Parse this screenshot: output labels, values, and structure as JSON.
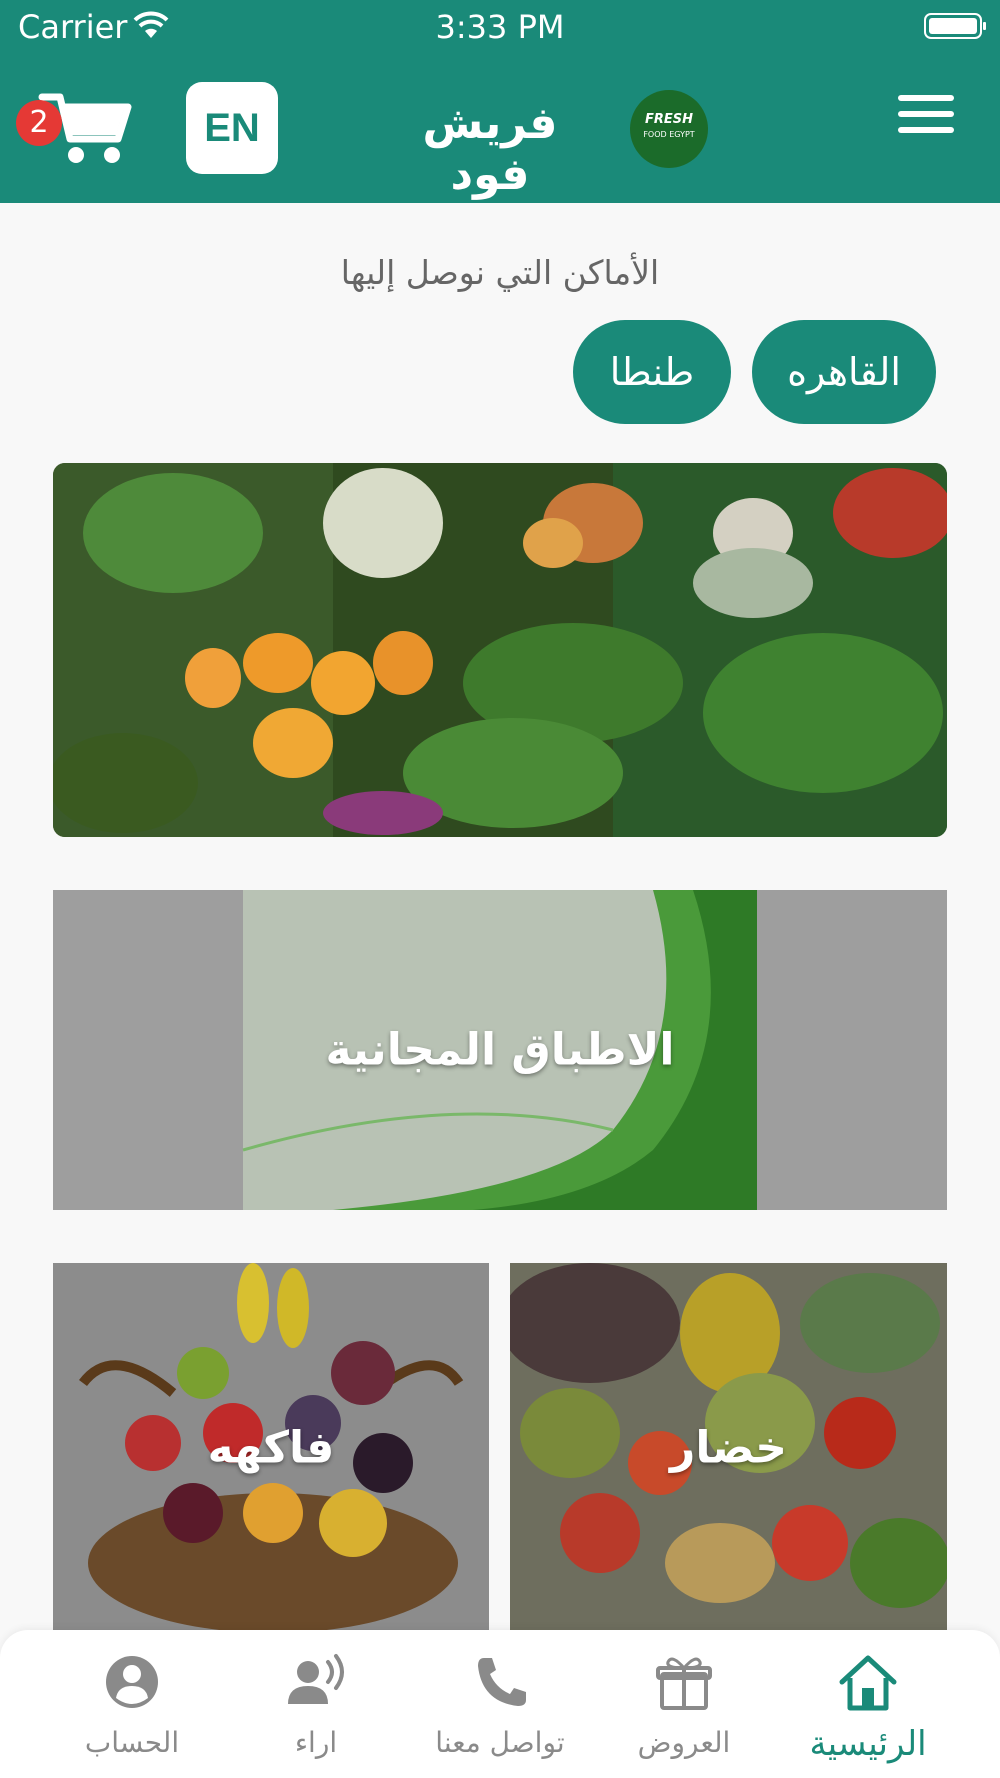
{
  "status_bar": {
    "carrier": "Carrier",
    "time": "3:33 PM"
  },
  "header": {
    "cart_count": "2",
    "language_button": "EN",
    "app_name": "فريش فود",
    "logo_text_top": "FRESH",
    "logo_text_bottom": "FOOD EGYPT"
  },
  "delivery": {
    "title": "الأماكن التي نوصل إليها",
    "areas": [
      "القاهره",
      "طنطا"
    ]
  },
  "banner": {
    "icon": "vegetables-market-image"
  },
  "categories": {
    "free_dishes": "الاطباق المجانية",
    "fruits": "فاكهه",
    "vegetables": "خضار"
  },
  "tabs": [
    {
      "label": "الرئيسية",
      "icon": "home-icon",
      "active": true
    },
    {
      "label": "العروض",
      "icon": "gift-icon",
      "active": false
    },
    {
      "label": "تواصل معنا",
      "icon": "phone-icon",
      "active": false
    },
    {
      "label": "اراء",
      "icon": "feedback-icon",
      "active": false
    },
    {
      "label": "الحساب",
      "icon": "account-icon",
      "active": false
    }
  ],
  "colors": {
    "primary": "#1a8a79",
    "badge": "#e53935",
    "inactive_tab": "#8a8a8a"
  }
}
